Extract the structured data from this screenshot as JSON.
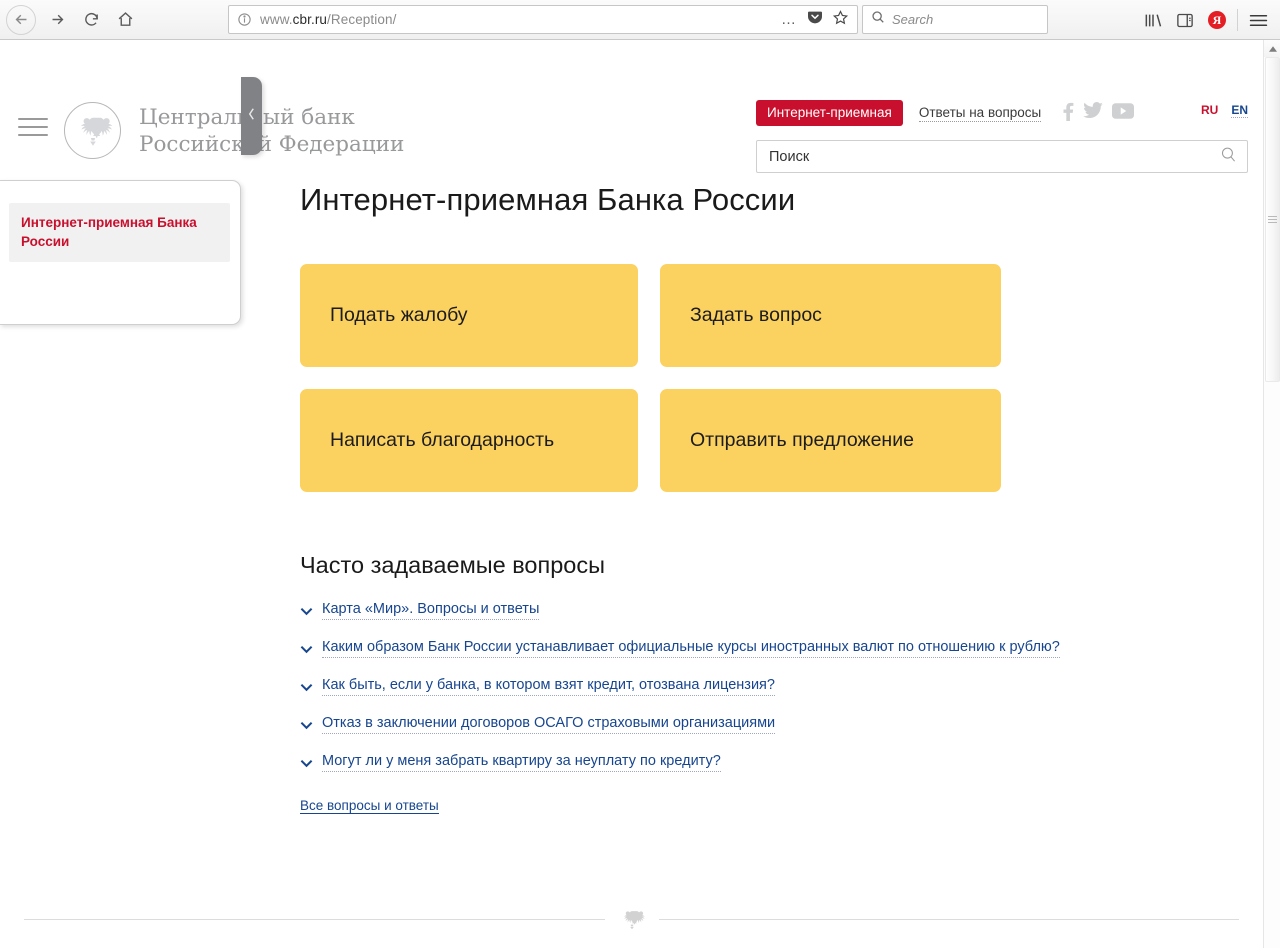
{
  "browser": {
    "nav": {
      "back_label": "Back",
      "forward_label": "Forward",
      "reload_label": "Reload",
      "home_label": "Home"
    },
    "url": {
      "prefix": "www.",
      "host": "cbr.ru",
      "path": "/Reception/",
      "info_tooltip": "Site information"
    },
    "search": {
      "placeholder": "Search"
    },
    "icons": {
      "page_actions": "…",
      "pocket": "pocket-icon",
      "bookmark": "star-icon",
      "library": "library-icon",
      "sidebar": "sidebar-icon",
      "yandex": "Я",
      "menu": "hamburger-menu-icon"
    }
  },
  "site": {
    "brand": {
      "line1": "Центральный банк",
      "line2": "Российской Федерации",
      "emblem": "double-headed-eagle-emblem"
    },
    "header": {
      "tab_internet_reception": "Интернет-приемная",
      "tab_answers": "Ответы на вопросы",
      "social": [
        {
          "name": "facebook-icon",
          "label": "Facebook"
        },
        {
          "name": "twitter-icon",
          "label": "Twitter"
        },
        {
          "name": "youtube-icon",
          "label": "YouTube"
        }
      ],
      "lang_ru": "RU",
      "lang_en": "EN"
    },
    "search": {
      "placeholder": "Поиск",
      "icon": "magnifier-icon"
    },
    "sidebar": {
      "items": [
        {
          "label": "Интернет-приемная Банка России",
          "active": true
        }
      ],
      "collapse_icon": "chevron-left-icon"
    },
    "main": {
      "title": "Интернет-приемная Банка России",
      "tiles": [
        {
          "label": "Подать жалобу"
        },
        {
          "label": "Задать вопрос"
        },
        {
          "label": "Написать благодарность"
        },
        {
          "label": "Отправить предложение"
        }
      ],
      "faq_title": "Часто задаваемые вопросы",
      "faq_items": [
        {
          "label": "Карта «Мир». Вопросы и ответы"
        },
        {
          "label": "Каким образом Банк России устанавливает официальные курсы иностранных валют по отношению к рублю?"
        },
        {
          "label": "Как быть, если у банка, в котором взят кредит, отозвана лицензия?"
        },
        {
          "label": "Отказ в заключении договоров ОСАГО страховыми организациями"
        },
        {
          "label": "Могут ли у меня забрать квартиру за неуплату по кредиту?"
        }
      ],
      "faq_all_label": "Все вопросы и ответы"
    },
    "footer": {
      "emblem": "eagle-divider-emblem"
    }
  },
  "colors": {
    "brand_red": "#c8102e",
    "tile_yellow": "#fbd160",
    "link_blue": "#17468f",
    "brand_gray": "#98999b"
  }
}
